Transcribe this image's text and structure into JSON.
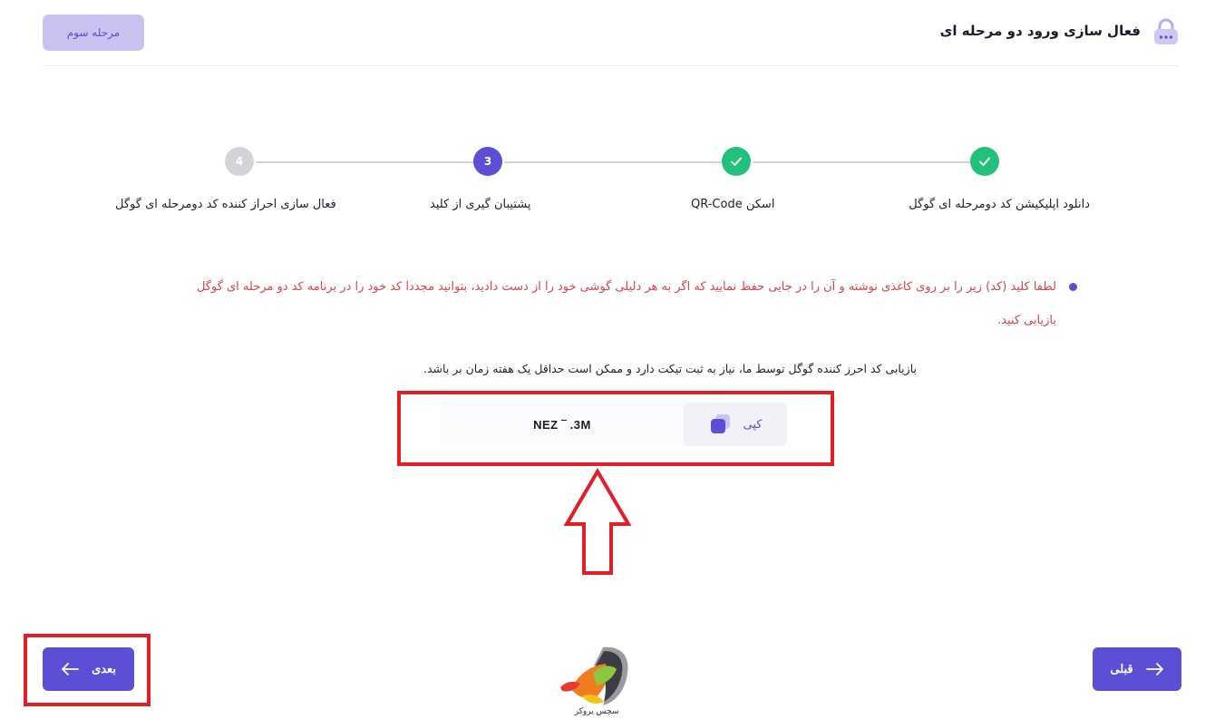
{
  "header": {
    "title": "فعال سازی ورود دو مرحله ای",
    "stage_badge": "مرحله سوم"
  },
  "steps": [
    {
      "label": "دانلود اپلیکیشن کد دومرحله ای گوگل",
      "status": "done"
    },
    {
      "label": "اسکن QR-Code",
      "status": "done"
    },
    {
      "label": "پشتیبان گیری از کلید",
      "status": "active",
      "number": "3"
    },
    {
      "label": "فعال سازی احراز کننده کد دومرحله ای گوگل",
      "status": "pending",
      "number": "4"
    }
  ],
  "note": "لطفا کلید (کد) زیر را بر روی کاغذی نوشته و آن را در جایی حفظ نمایید که اگر به هر دلیلی گوشی خود را از دست دادید، بتوانید مجددا کد خود را در برنامه کد دو مرحله ای گوگل بازیابی کنید.",
  "recovery_info": "بازیابی کد احرز کننده گوگل توسط ما، نیاز به ثبت تیکت دارد و ممکن است حداقل یک هفته زمان بر باشد.",
  "code": {
    "value": "NEZ          ‾   .3M",
    "copy_label": "کپی"
  },
  "buttons": {
    "next": "بعدی",
    "prev": "قبلی"
  },
  "logo": {
    "text": "سچس بروکر"
  },
  "colors": {
    "primary": "#5b4fd6",
    "success": "#22c07a",
    "pending": "#d3d4da",
    "note": "#d9434a",
    "highlight": "#e41e26"
  }
}
